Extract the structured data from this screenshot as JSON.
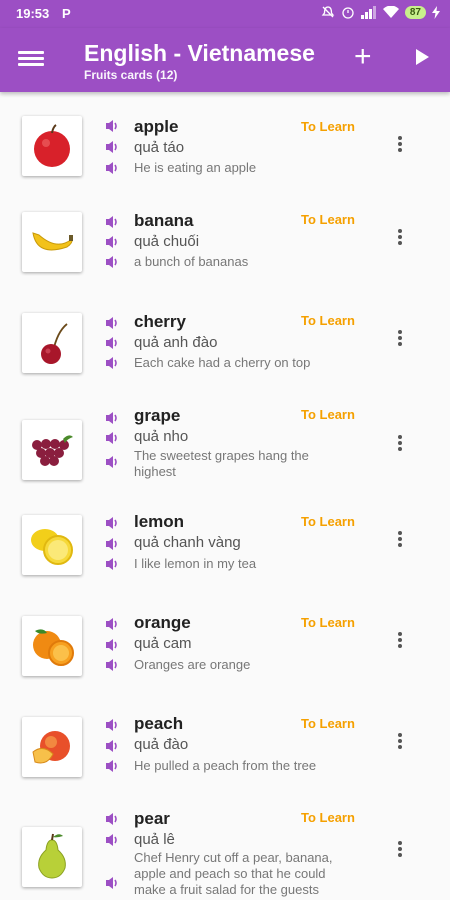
{
  "status_bar": {
    "time": "19:53",
    "carrier_icon": "P",
    "battery": "87"
  },
  "header": {
    "title": "English - Vietnamese",
    "subtitle": "Fruits cards (12)"
  },
  "cards": [
    {
      "image": "apple-image",
      "word": "apple",
      "translation": "quả táo",
      "example": "He is eating an apple",
      "status": "To Learn"
    },
    {
      "image": "banana-image",
      "word": "banana",
      "translation": "quả chuối",
      "example": "a bunch of bananas",
      "status": "To Learn"
    },
    {
      "image": "cherry-image",
      "word": "cherry",
      "translation": "quả anh đào",
      "example": "Each cake had a cherry on top",
      "status": "To Learn"
    },
    {
      "image": "grape-image",
      "word": "grape",
      "translation": "quả nho",
      "example": "The sweetest grapes hang the highest",
      "status": "To Learn"
    },
    {
      "image": "lemon-image",
      "word": "lemon",
      "translation": "quả chanh vàng",
      "example": "I like lemon in my tea",
      "status": "To Learn"
    },
    {
      "image": "orange-image",
      "word": "orange",
      "translation": "quả cam",
      "example": "Oranges are orange",
      "status": "To Learn"
    },
    {
      "image": "peach-image",
      "word": "peach",
      "translation": "quả đào",
      "example": "He pulled a peach from the tree",
      "status": "To Learn"
    },
    {
      "image": "pear-image",
      "word": "pear",
      "translation": "quả lê",
      "example": "Chef Henry cut off a pear, banana, apple and peach so that he could make a fruit salad for the guests",
      "status": "To Learn"
    }
  ],
  "colors": {
    "primary": "#9c4fc4",
    "speaker": "#9c4fc4",
    "status": "#f5a000"
  }
}
